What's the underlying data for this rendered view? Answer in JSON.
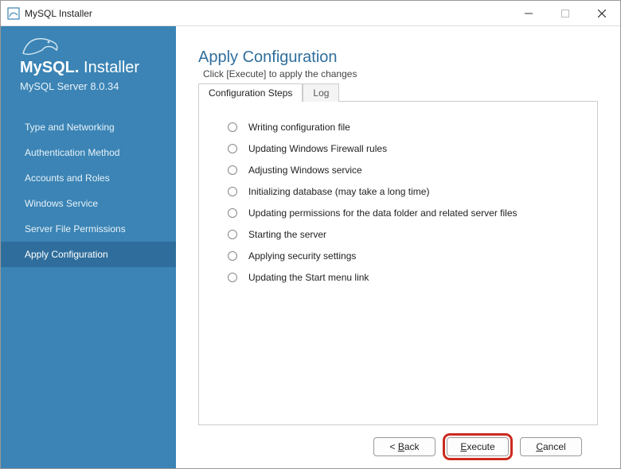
{
  "window": {
    "title": "MySQL Installer"
  },
  "sidebar": {
    "brand_main": "MySQL.",
    "brand_sub": "Installer",
    "product": "MySQL Server 8.0.34",
    "items": [
      {
        "label": "Type and Networking"
      },
      {
        "label": "Authentication Method"
      },
      {
        "label": "Accounts and Roles"
      },
      {
        "label": "Windows Service"
      },
      {
        "label": "Server File Permissions"
      },
      {
        "label": "Apply Configuration"
      }
    ],
    "active_index": 5
  },
  "main": {
    "title": "Apply Configuration",
    "subtitle": "Click [Execute] to apply the changes",
    "tabs": [
      {
        "label": "Configuration Steps"
      },
      {
        "label": "Log"
      }
    ],
    "active_tab": 0,
    "steps": [
      {
        "label": "Writing configuration file"
      },
      {
        "label": "Updating Windows Firewall rules"
      },
      {
        "label": "Adjusting Windows service"
      },
      {
        "label": "Initializing database (may take a long time)"
      },
      {
        "label": "Updating permissions for the data folder and related server files"
      },
      {
        "label": "Starting the server"
      },
      {
        "label": "Applying security settings"
      },
      {
        "label": "Updating the Start menu link"
      }
    ]
  },
  "footer": {
    "back": "Back",
    "execute": "Execute",
    "cancel": "Cancel"
  }
}
